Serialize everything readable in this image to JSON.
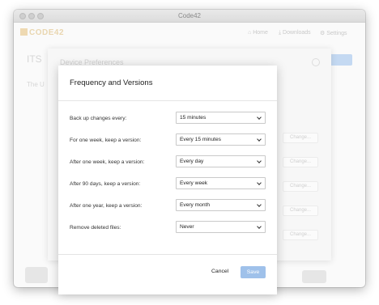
{
  "window": {
    "title": "Code42"
  },
  "header": {
    "logo_text": "CODE42",
    "nav": {
      "home": "Home",
      "downloads": "Downloads",
      "settings": "Settings"
    }
  },
  "background": {
    "page_title_fragment": "ITS",
    "page_subtitle_fragment": "The U",
    "panel_title": "Device Preferences",
    "change_label": "Change..."
  },
  "modal": {
    "title": "Frequency and Versions",
    "rows": [
      {
        "label": "Back up changes every:",
        "value": "15 minutes"
      },
      {
        "label": "For one week, keep a version:",
        "value": "Every 15 minutes"
      },
      {
        "label": "After one week, keep a version:",
        "value": "Every day"
      },
      {
        "label": "After 90 days, keep a version:",
        "value": "Every week"
      },
      {
        "label": "After one year, keep a version:",
        "value": "Every month"
      },
      {
        "label": "Remove deleted files:",
        "value": "Never"
      }
    ],
    "cancel_label": "Cancel",
    "save_label": "Save"
  },
  "colors": {
    "save_button": "#9fc1ea",
    "logo": "#e9d6b0"
  }
}
